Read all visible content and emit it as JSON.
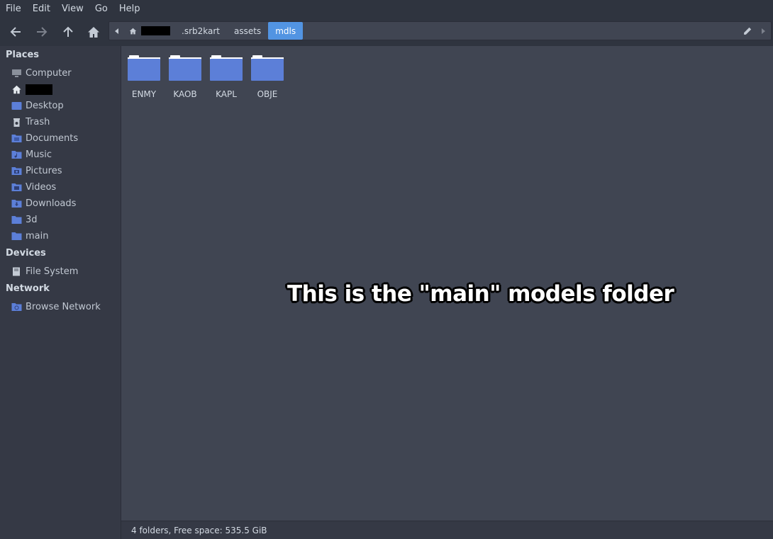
{
  "menubar": {
    "items": [
      "File",
      "Edit",
      "View",
      "Go",
      "Help"
    ]
  },
  "toolbar": {
    "back_icon": "arrow-left-icon",
    "forward_icon": "arrow-right-icon",
    "up_icon": "arrow-up-icon",
    "home_icon": "home-icon"
  },
  "pathbar": {
    "crumbs": [
      ".srb2kart",
      "assets",
      "mdls"
    ],
    "active": "mdls",
    "edit_icon": "pencil-icon"
  },
  "sidebar": {
    "places_title": "Places",
    "places": [
      {
        "label": "Computer",
        "icon": "computer-icon"
      },
      {
        "label": "",
        "icon": "home-icon"
      },
      {
        "label": "Desktop",
        "icon": "desktop-folder-icon"
      },
      {
        "label": "Trash",
        "icon": "trash-icon"
      },
      {
        "label": "Documents",
        "icon": "documents-folder-icon"
      },
      {
        "label": "Music",
        "icon": "music-folder-icon"
      },
      {
        "label": "Pictures",
        "icon": "pictures-folder-icon"
      },
      {
        "label": "Videos",
        "icon": "videos-folder-icon"
      },
      {
        "label": "Downloads",
        "icon": "downloads-folder-icon"
      },
      {
        "label": "3d",
        "icon": "folder-icon"
      },
      {
        "label": "main",
        "icon": "folder-icon"
      }
    ],
    "devices_title": "Devices",
    "devices": [
      {
        "label": "File System",
        "icon": "drive-icon"
      }
    ],
    "network_title": "Network",
    "network": [
      {
        "label": "Browse Network",
        "icon": "network-icon"
      }
    ]
  },
  "files": [
    {
      "name": "ENMY",
      "icon": "folder-icon"
    },
    {
      "name": "KAOB",
      "icon": "folder-icon"
    },
    {
      "name": "KAPL",
      "icon": "folder-icon"
    },
    {
      "name": "OBJE",
      "icon": "folder-icon"
    }
  ],
  "overlay": {
    "text": "This is the \"main\" models folder"
  },
  "statusbar": {
    "text": "4 folders, Free space: 535.5  GiB"
  },
  "colors": {
    "accent": "#5294e2",
    "folder": "#5c7fd8",
    "window_bg": "#404552",
    "sidebar_bg": "#353945"
  }
}
